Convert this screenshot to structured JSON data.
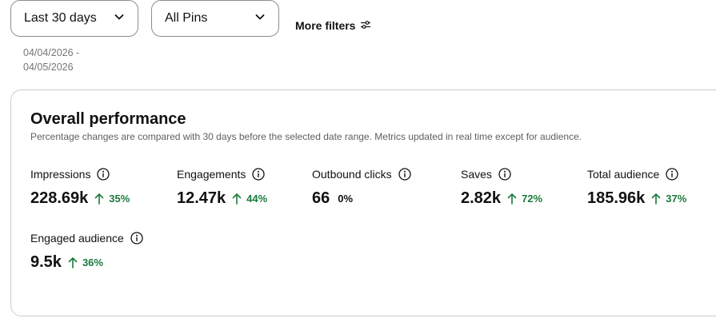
{
  "filters": {
    "date_range": {
      "label": "Last 30 days",
      "dates": "04/04/2026 - 04/05/2026"
    },
    "pins": {
      "label": "All Pins"
    },
    "more_filters": {
      "label": "More filters"
    }
  },
  "overall": {
    "title": "Overall performance",
    "subtitle": "Percentage changes are compared with 30 days before the selected date range. Metrics updated in real time except for audience.",
    "metrics": [
      {
        "label": "Impressions",
        "value": "228.69k",
        "change": "35%",
        "direction": "up"
      },
      {
        "label": "Engagements",
        "value": "12.47k",
        "change": "44%",
        "direction": "up"
      },
      {
        "label": "Outbound clicks",
        "value": "66",
        "change": "0%",
        "direction": "none"
      },
      {
        "label": "Saves",
        "value": "2.82k",
        "change": "72%",
        "direction": "up"
      },
      {
        "label": "Total audience",
        "value": "185.96k",
        "change": "37%",
        "direction": "up"
      },
      {
        "label": "Engaged audience",
        "value": "9.5k",
        "change": "36%",
        "direction": "up"
      }
    ]
  },
  "colors": {
    "positive": "#1a7a3c",
    "border": "#cdcdcd",
    "muted_text": "#767676"
  }
}
